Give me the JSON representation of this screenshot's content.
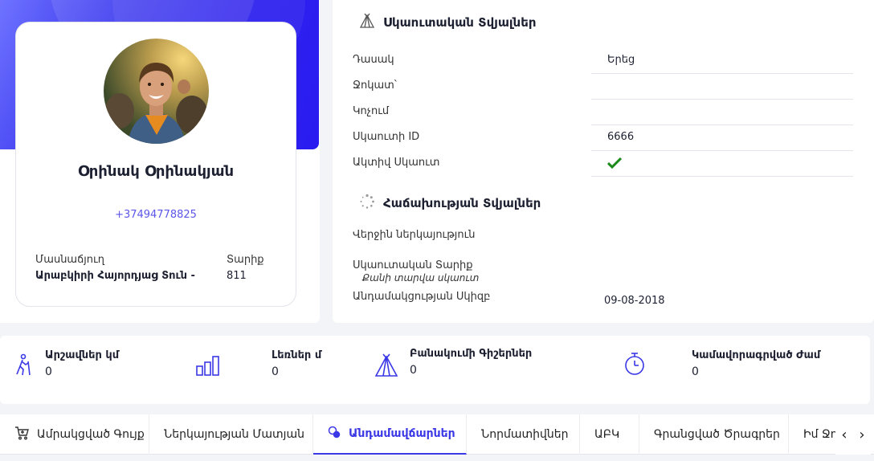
{
  "profile": {
    "name": "Օրինակ Օրինակյան",
    "phone": "+37494778825",
    "org_label": "Մասնաճյուղ",
    "org_value": "Արաբկիրի Հայորդյաց Տուն -",
    "troop_label": "Տարիք",
    "troop_value": "811"
  },
  "scout_info": {
    "title": "Սկաուտական Տվյալներ",
    "rows": [
      {
        "label": "Դասակ",
        "value": "Երեց"
      },
      {
        "label": "Ջոկատ՝",
        "value": ""
      },
      {
        "label": "Կոչում",
        "value": ""
      },
      {
        "label": "Սկաուտի ID",
        "value": "6666"
      },
      {
        "label": "Ակտիվ Սկաուտ",
        "value": ""
      }
    ]
  },
  "attendance": {
    "title": "Հաճախության Տվյալներ",
    "last_attendance_label": "Վերջին ներկայություն",
    "scout_year_label": "Սկաուտական Տարիք",
    "scout_year_sub": "Քանի տարվա սկաուտ",
    "member_since_label": "Անդամակցության Սկիզբ",
    "member_since_value": "09-08-2018"
  },
  "stats": [
    {
      "title": "Արշավներ կմ",
      "value": "0",
      "icon": "hiking-icon"
    },
    {
      "title": "Լեռներ մ",
      "value": "0",
      "icon": "bar-chart-icon"
    },
    {
      "title": "Բանակումի Գիշերներ",
      "value": "0",
      "icon": "tent-icon"
    },
    {
      "title": "Կամավորագրված Ժամ",
      "value": "0",
      "icon": "stopwatch-icon"
    }
  ],
  "tabs": [
    {
      "label": "Ամրակցված Գույք",
      "icon": "cart-icon"
    },
    {
      "label": "Ներկայության Մատյան"
    },
    {
      "label": "Անդամավճարներ",
      "icon": "coins-icon",
      "active": true
    },
    {
      "label": "Նորմատիվներ"
    },
    {
      "label": "ԱԲԿ"
    },
    {
      "label": "Գրանցված Ծրագրեր"
    },
    {
      "label": "Իմ Ջոկ"
    }
  ],
  "colors": {
    "accent": "#3b38e6",
    "hero": "#2e22ee",
    "check": "#1a8a1a"
  }
}
